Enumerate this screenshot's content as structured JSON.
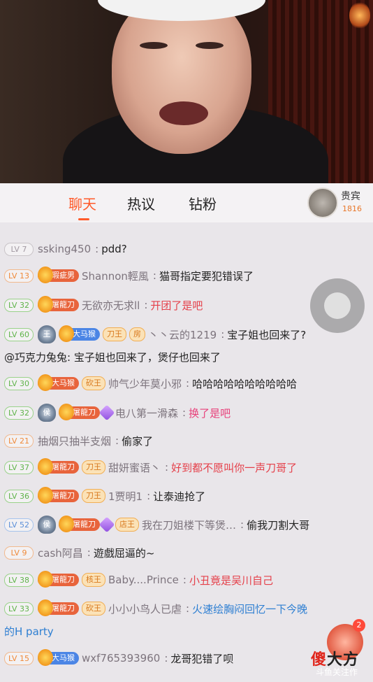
{
  "tabs": {
    "chat": "聊天",
    "hot": "热议",
    "fans": "钻粉"
  },
  "vip": {
    "label": "贵宾",
    "count": "1816"
  },
  "messages": [
    {
      "lv": "LV 7",
      "name": "ssking450",
      "colon": ":",
      "text": "pdd?"
    },
    {
      "lv": "LV 13",
      "badge": "瑕疵男",
      "name": "Shannon輕風",
      "colon": ":",
      "text": "猫哥指定要犯错误了"
    },
    {
      "lv": "LV 32",
      "badge": "屠龍刀",
      "name": "无欲亦无求ll",
      "colon": ":",
      "text": "开团了是吧"
    },
    {
      "lv": "LV 60",
      "shield": "王",
      "badge": "大马猴",
      "small": "刀王",
      "small2": "房",
      "name": "丶丶云的1219",
      "colon": ":",
      "text": "宝子姐也回来了?"
    },
    {
      "text": "@巧克力兔兔: 宝子姐也回来了，煲仔也回来了"
    },
    {
      "lv": "LV 30",
      "badge": "大马猴",
      "small": "砍王",
      "name": "帅气少年莫小邪",
      "colon": ":",
      "text": "哈哈哈哈哈哈哈哈哈哈"
    },
    {
      "lv": "LV 32",
      "shield": "侯",
      "badge": "屠龍刀",
      "name": "电八第一滑森",
      "colon": ":",
      "text": "换了是吧"
    },
    {
      "lv": "LV 21",
      "name": "抽烟只抽半支烟",
      "colon": ":",
      "text": "偷家了"
    },
    {
      "lv": "LV 37",
      "badge": "屠龍刀",
      "small": "刀王",
      "name": "甜妍蜜语丶",
      "colon": ":",
      "text": "好到都不愿叫你一声刀哥了"
    },
    {
      "lv": "LV 36",
      "badge": "屠龍刀",
      "small": "刀王",
      "name": "1贾明1",
      "colon": ":",
      "text": "让泰迪抢了"
    },
    {
      "lv": "LV 52",
      "shield": "侯",
      "badge": "屠龍刀",
      "small": "店王",
      "name": "我在刀姐楼下等煲…",
      "colon": ":",
      "text": "偷我刀割大哥"
    },
    {
      "lv": "LV 9",
      "name": "cash阿昌",
      "colon": ":",
      "text": "遊戲屈逼的~"
    },
    {
      "lv": "LV 38",
      "badge": "屠龍刀",
      "small": "核王",
      "name": "Baby....Prince",
      "colon": ":",
      "text": "小丑竟是吴川自己"
    },
    {
      "lv": "LV 33",
      "badge": "屠龍刀",
      "small": "砍王",
      "name": "小小小鸟人已虐",
      "colon": ":",
      "text": "火速绘胸闷回忆一下今晚"
    },
    {
      "text": "的H party"
    },
    {
      "lv": "LV 15",
      "badge": "大马猴",
      "name": "wxf765393960",
      "colon": ":",
      "text": "龙哥犯错了呗"
    }
  ],
  "gift_count": "2",
  "watermark": {
    "a": "傻",
    "b": "大方",
    "sub": "斗鱼关注作"
  },
  "colors": {
    "accent": "#ff5a2a",
    "lv_green": "#5fb34a",
    "msg_red": "#e5404a",
    "msg_blue": "#2e7fd2"
  }
}
